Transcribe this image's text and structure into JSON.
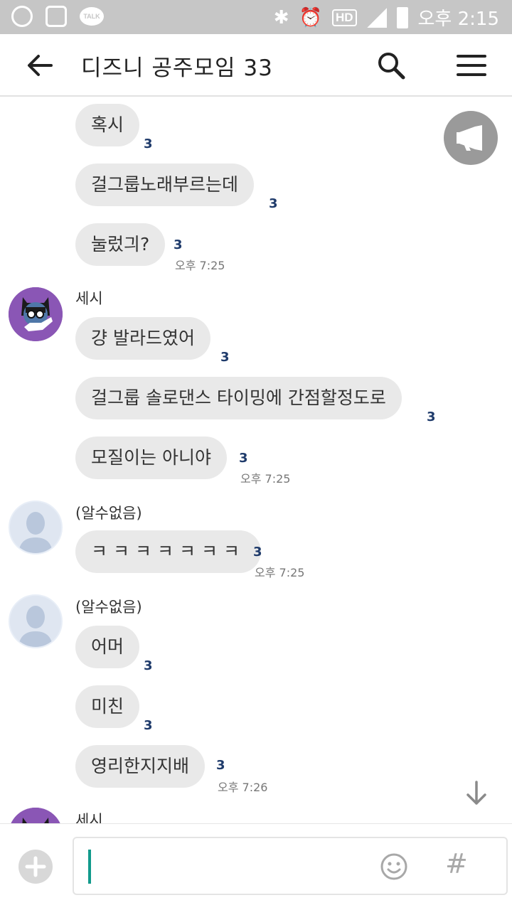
{
  "status_bar": {
    "talk_label": "TALK",
    "hd_label": "HD",
    "time": "오후 2:15",
    "icons": [
      "olleh-icon",
      "gallery-icon",
      "talk-icon",
      "bluetooth-icon",
      "alarm-icon",
      "hd-call-icon",
      "signal-icon",
      "battery-icon"
    ]
  },
  "header": {
    "title": "디즈니 공주모임 33"
  },
  "messages": [
    {
      "text": "혹시",
      "unread": "3"
    },
    {
      "text": "걸그룹노래부르는데",
      "unread": "3"
    },
    {
      "text": "눌렀긔?",
      "unread": "3",
      "time": "오후 7:25"
    },
    {
      "sender": "세시",
      "text": "걍 발라드였어",
      "unread": "3"
    },
    {
      "text": "걸그룹 솔로댄스 타이밍에 간점할정도로",
      "unread": "3"
    },
    {
      "text": "모질이는 아니야",
      "unread": "3",
      "time": "오후 7:25"
    },
    {
      "sender": "(알수없음)",
      "text": "ㅋㅋㅋㅋㅋㅋㅋ",
      "unread": "3",
      "time": "오후 7:25"
    },
    {
      "sender": "(알수없음)",
      "text": "어머",
      "unread": "3"
    },
    {
      "text": "미친",
      "unread": "3"
    },
    {
      "text": "영리한지지배",
      "unread": "3",
      "time": "오후 7:26"
    },
    {
      "sender": "세시"
    }
  ],
  "input": {
    "value": "",
    "hash_label": "#"
  },
  "colors": {
    "status_bar": "#c6c6c6",
    "bubble": "#e9e9e9",
    "unread": "#1f3b6b",
    "cursor": "#129a8c",
    "avatar_purple": "#8a56b5"
  }
}
